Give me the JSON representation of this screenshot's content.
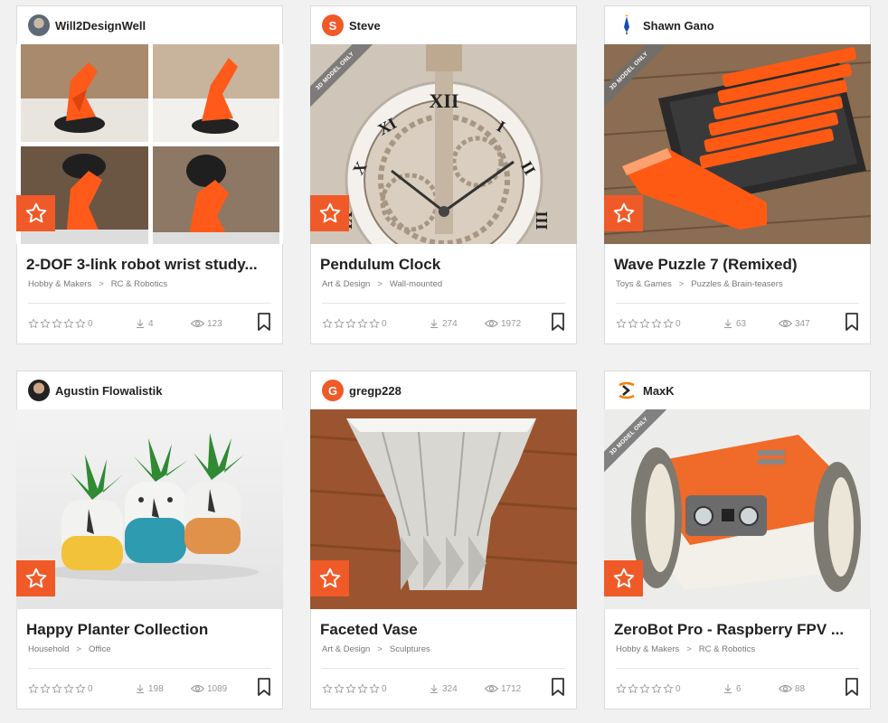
{
  "ribbon_text": "3D MODEL ONLY",
  "accent": "#f05a28",
  "cards": [
    {
      "author": "Will2DesignWell",
      "avatar_icon": "user-photo",
      "title": "2-DOF 3-link robot wrist study...",
      "category": "Hobby & Makers",
      "subcategory": "RC & Robotics",
      "rating": "0",
      "downloads": "4",
      "views": "123"
    },
    {
      "author": "Steve",
      "avatar_letter": "S",
      "title": "Pendulum Clock",
      "category": "Art & Design",
      "subcategory": "Wall-mounted",
      "rating": "0",
      "downloads": "274",
      "views": "1972"
    },
    {
      "author": "Shawn Gano",
      "avatar_icon": "pencil",
      "title": "Wave Puzzle 7 (Remixed)",
      "category": "Toys & Games",
      "subcategory": "Puzzles & Brain-teasers",
      "rating": "0",
      "downloads": "63",
      "views": "347"
    },
    {
      "author": "Agustin Flowalistik",
      "avatar_icon": "user-photo",
      "title": "Happy Planter Collection",
      "category": "Household",
      "subcategory": "Office",
      "rating": "0",
      "downloads": "198",
      "views": "1089"
    },
    {
      "author": "gregp228",
      "avatar_letter": "G",
      "title": "Faceted Vase",
      "category": "Art & Design",
      "subcategory": "Sculptures",
      "rating": "0",
      "downloads": "324",
      "views": "1712"
    },
    {
      "author": "MaxK",
      "avatar_icon": "maxk-logo",
      "title": "ZeroBot Pro - Raspberry FPV ...",
      "category": "Hobby & Makers",
      "subcategory": "RC & Robotics",
      "rating": "0",
      "downloads": "6",
      "views": "88"
    }
  ],
  "separator": ">"
}
